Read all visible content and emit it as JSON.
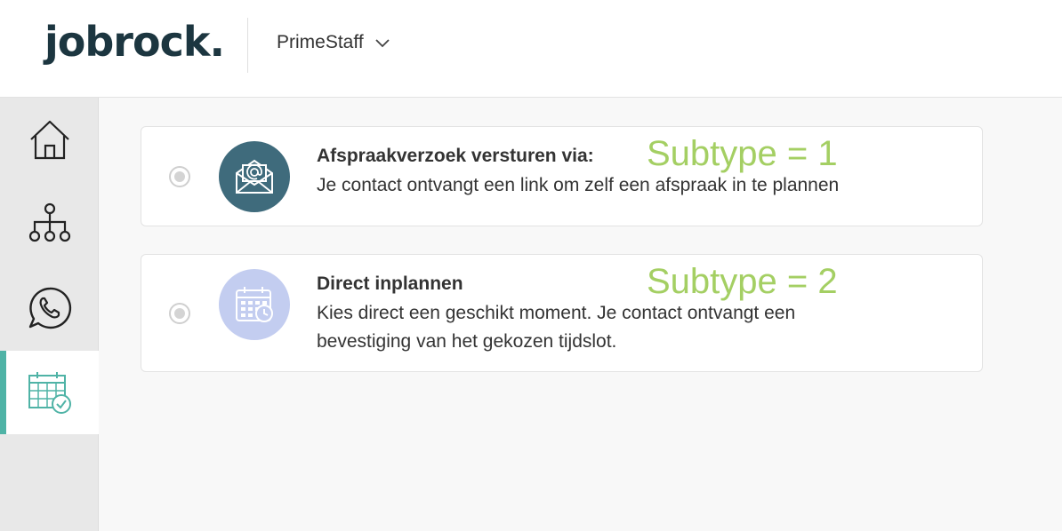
{
  "header": {
    "logo_text": "jobrock.",
    "org_name": "PrimeStaff"
  },
  "sidebar": {
    "items": [
      {
        "icon": "home-icon"
      },
      {
        "icon": "org-chart-icon"
      },
      {
        "icon": "whatsapp-icon"
      },
      {
        "icon": "calendar-check-icon",
        "active": true
      }
    ]
  },
  "options": [
    {
      "icon": "email-invite-icon",
      "icon_bg": "#3f6b7c",
      "title": "Afspraakverzoek versturen via:",
      "description": "Je contact ontvangt een link om zelf een afspraak in te plannen",
      "annotation": "Subtype = 1"
    },
    {
      "icon": "calendar-clock-icon",
      "icon_bg": "#c3cdf0",
      "title": "Direct inplannen",
      "description": "Kies direct een geschikt moment. Je contact ontvangt een bevestiging van het gekozen tijdslot.",
      "annotation": "Subtype = 2"
    }
  ],
  "colors": {
    "accent": "#4fb3a6",
    "logo": "#1c3640",
    "annotation": "#a4cf63"
  }
}
